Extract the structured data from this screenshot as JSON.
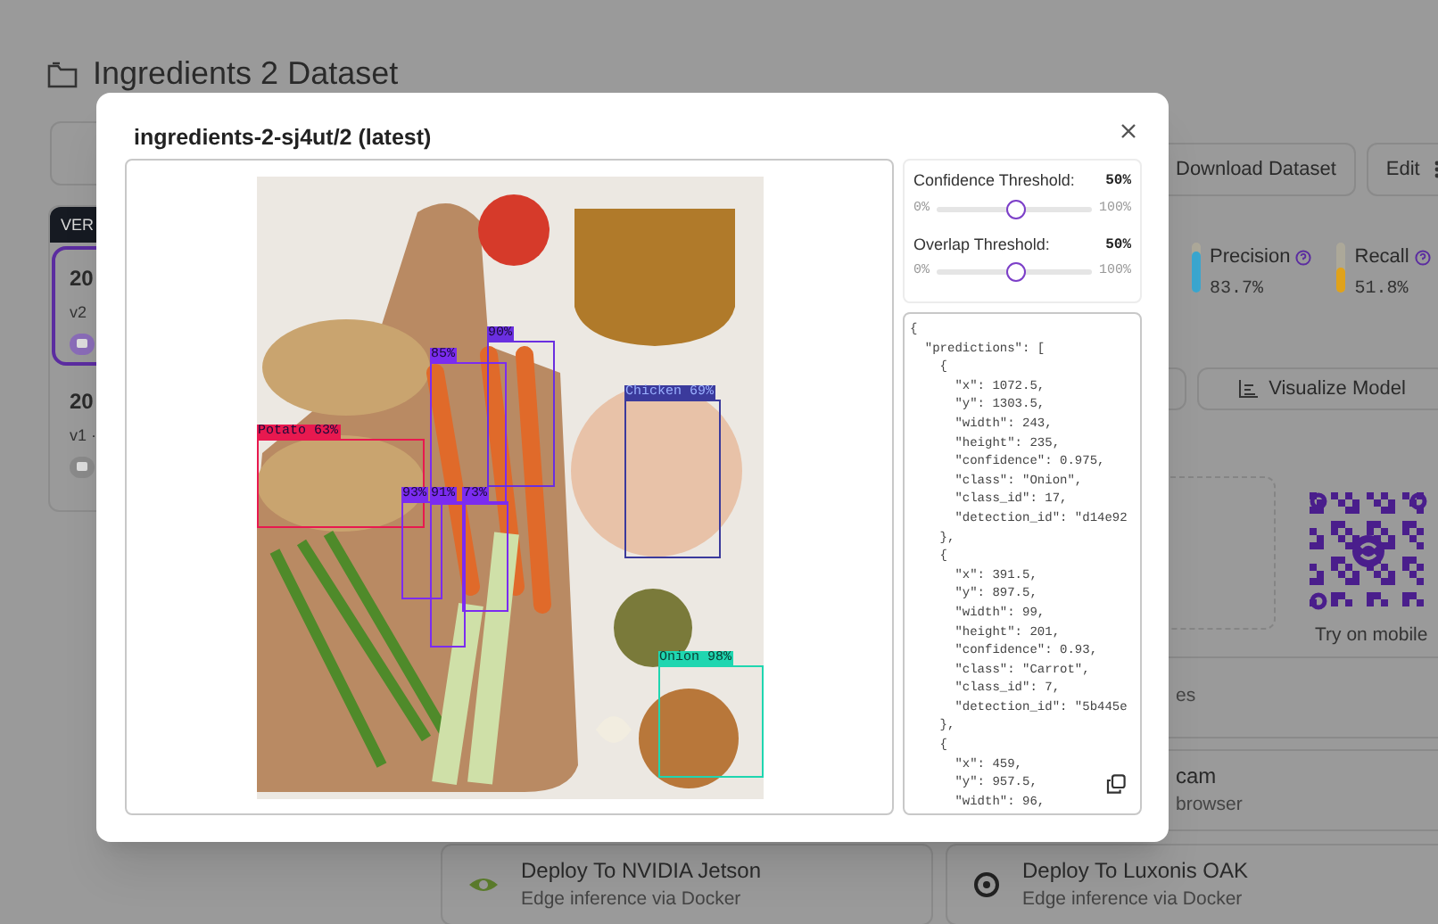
{
  "page": {
    "title": "Ingredients 2 Dataset",
    "sidebar": {
      "header": "VER",
      "versions": [
        {
          "name": "20",
          "version": "v2",
          "selected": true
        },
        {
          "name": "20",
          "version": "v1 ·",
          "selected": false
        }
      ]
    },
    "actions": [
      "Download Dataset",
      "Edit"
    ],
    "metrics": [
      {
        "label": "Precision",
        "value": "83.7%",
        "color": "#3aa6cf",
        "level": 0.837
      },
      {
        "label": "Recall",
        "value": "51.8%",
        "color": "#e0a21a",
        "level": 0.518
      }
    ],
    "visualize_button": "Visualize Model",
    "qr_caption": "Try on mobile",
    "deploy_cards": [
      {
        "subtitle": "es"
      },
      {
        "title": "cam",
        "subtitle": "browser"
      },
      {
        "title": "Deploy To NVIDIA Jetson",
        "subtitle": "Edge inference via Docker",
        "kind": "nvidia"
      },
      {
        "title": "Deploy To Luxonis OAK",
        "subtitle": "Edge inference via Docker",
        "kind": "luxonis"
      }
    ]
  },
  "modal": {
    "title": "ingredients-2-sj4ut/2 (latest)",
    "detections": [
      {
        "label": "Potato 63%",
        "color": "#e8194f"
      },
      {
        "label": "85%",
        "color": "#7b2cf0"
      },
      {
        "label": "90%",
        "color": "#6a2fe0"
      },
      {
        "label": "Chicken 69%",
        "color": "#3b3a9c"
      },
      {
        "label": "93%",
        "color": "#7b2cf0"
      },
      {
        "label": "91%",
        "color": "#7b2cf0"
      },
      {
        "label": "73%",
        "color": "#7b2cf0"
      },
      {
        "label": "Onion 98%",
        "color": "#1fd6b0"
      }
    ],
    "thresholds": [
      {
        "label": "Confidence Threshold:",
        "value": "50%",
        "min": "0%",
        "max": "100%",
        "level": 0.5
      },
      {
        "label": "Overlap Threshold:",
        "value": "50%",
        "min": "0%",
        "max": "100%",
        "level": 0.5
      }
    ],
    "json_output": [
      "{",
      "  \"predictions\": [",
      "    {",
      "      \"x\": 1072.5,",
      "      \"y\": 1303.5,",
      "      \"width\": 243,",
      "      \"height\": 235,",
      "      \"confidence\": 0.975,",
      "      \"class\": \"Onion\",",
      "      \"class_id\": 17,",
      "      \"detection_id\": \"d14e92",
      "    },",
      "    {",
      "      \"x\": 391.5,",
      "      \"y\": 897.5,",
      "      \"width\": 99,",
      "      \"height\": 201,",
      "      \"confidence\": 0.93,",
      "      \"class\": \"Carrot\",",
      "      \"class_id\": 7,",
      "      \"detection_id\": \"5b445e",
      "    },",
      "    {",
      "      \"x\": 459,",
      "      \"y\": 957.5,",
      "      \"width\": 96,"
    ]
  }
}
